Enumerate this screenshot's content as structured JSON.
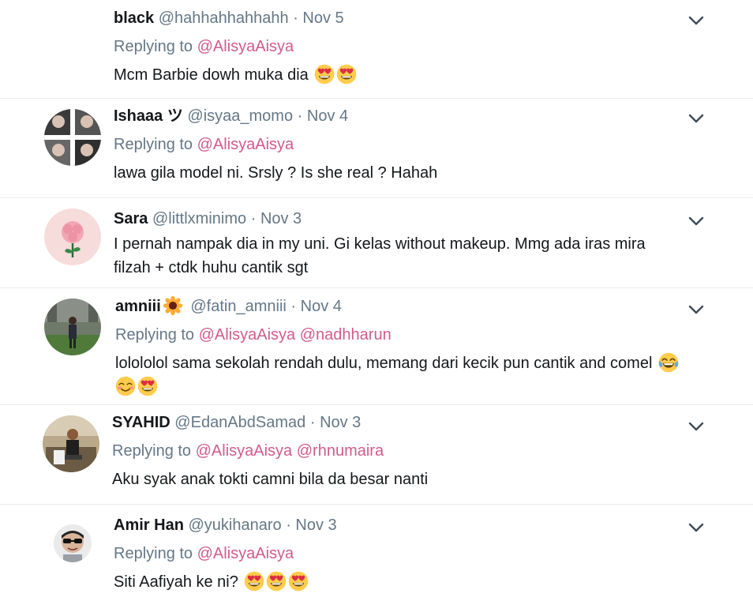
{
  "tweets": [
    {
      "name": "black",
      "handle": "@hahhahhahhahh",
      "date": "Nov 5",
      "replying_prefix": "Replying to",
      "mentions": [
        "@AlisyaAisya"
      ],
      "text": "Mcm Barbie dowh muka dia",
      "emojis": [
        "heart-eyes",
        "heart-eyes"
      ]
    },
    {
      "name": "Ishaaa ツ",
      "handle": "@isyaa_momo",
      "date": "Nov 4",
      "replying_prefix": "Replying to",
      "mentions": [
        "@AlisyaAisya"
      ],
      "text": "lawa gila model ni. Srsly ? Is she real ? Hahah"
    },
    {
      "name": "Sara",
      "handle": "@littlxminimo",
      "date": "Nov 3",
      "text_line1": "I pernah nampak dia in my uni. Gi kelas without makeup. Mmg ada iras mira",
      "text_line2": "filzah + ctdk huhu cantik sgt"
    },
    {
      "name": "amniii",
      "name_emoji": "sunflower",
      "handle": "@fatin_amniii",
      "date": "Nov 4",
      "replying_prefix": "Replying to",
      "mentions": [
        "@AlisyaAisya",
        "@nadhharun"
      ],
      "text": "lolololol sama sekolah rendah dulu, memang dari kecik pun cantik and comel",
      "emojis": [
        "tears-of-joy",
        "smiling-blush",
        "heart-eyes"
      ]
    },
    {
      "name": "SYAHID",
      "handle": "@EdanAbdSamad",
      "date": "Nov 3",
      "replying_prefix": "Replying to",
      "mentions": [
        "@AlisyaAisya",
        "@rhnumaira"
      ],
      "text": "Aku syak anak tokti camni bila da besar nanti"
    },
    {
      "name": "Amir Han",
      "handle": "@yukihanaro",
      "date": "Nov 3",
      "replying_prefix": "Replying to",
      "mentions": [
        "@AlisyaAisya"
      ],
      "text": "Siti Aafiyah ke ni?",
      "emojis": [
        "heart-eyes",
        "heart-eyes",
        "heart-eyes"
      ]
    }
  ],
  "separator": "·",
  "colors": {
    "text": "#14171a",
    "muted": "#657786",
    "mention": "#d15b8f",
    "divider": "#e6ecf0"
  }
}
